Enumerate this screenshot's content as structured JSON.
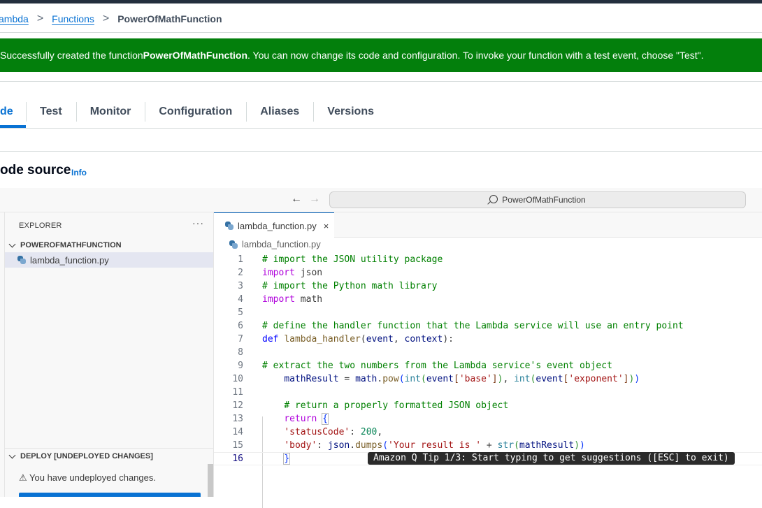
{
  "breadcrumb": {
    "items": [
      "ambda",
      "Functions"
    ],
    "current": "PowerOfMathFunction",
    "separator": ">"
  },
  "flash": {
    "prefix": "Successfully created the function ",
    "function_name": "PowerOfMathFunction",
    "suffix": ". You can now change its code and configuration. To invoke your function with a test event, choose \"Test\"."
  },
  "tabs": [
    {
      "label": "de",
      "active": true
    },
    {
      "label": "Test"
    },
    {
      "label": "Monitor"
    },
    {
      "label": "Configuration"
    },
    {
      "label": "Aliases"
    },
    {
      "label": "Versions"
    }
  ],
  "section": {
    "title": "ode source",
    "info": "Info"
  },
  "ide": {
    "nav_back": "←",
    "nav_forward": "→",
    "search_text": "PowerOfMathFunction",
    "explorer": {
      "title": "EXPLORER",
      "more": "···",
      "folder": "POWEROFMATHFUNCTION",
      "file": "lambda_function.py"
    },
    "deploy": {
      "header": "DEPLOY [UNDEPLOYED CHANGES]",
      "message": "⚠ You have undeployed changes."
    },
    "editor": {
      "tab_label": "lambda_function.py",
      "close": "×",
      "crumb": "lambda_function.py",
      "line_numbers": [
        "1",
        "2",
        "3",
        "4",
        "5",
        "6",
        "7",
        "8",
        "9",
        "10",
        "11",
        "12",
        "13",
        "14",
        "15",
        "16"
      ],
      "tip": "Amazon Q Tip 1/3: Start typing to get suggestions ([ESC] to exit)"
    }
  },
  "colors": {
    "flash_bg": "#037f0c",
    "link": "#0972d3",
    "top_bar": "#232f3e"
  }
}
